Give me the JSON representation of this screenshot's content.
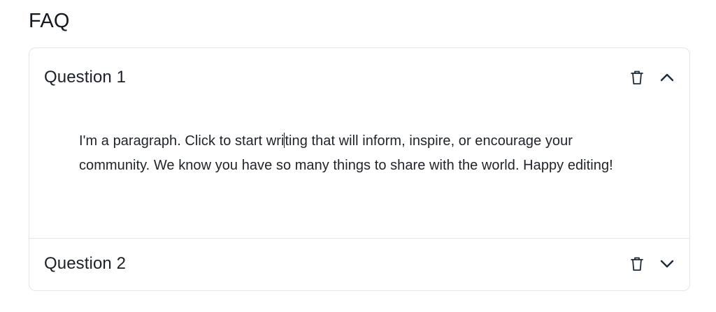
{
  "section": {
    "title": "FAQ"
  },
  "faq": {
    "items": [
      {
        "question": "Question 1",
        "answer_before_caret": "I'm a paragraph. Click to start wri",
        "answer_after_caret": "ting that will inform, inspire, or encourage your community. We know you have so many things to share with the world. Happy editing!",
        "expanded": true,
        "delete_icon": "trash-icon",
        "toggle_icon": "chevron-up-icon"
      },
      {
        "question": "Question 2",
        "expanded": false,
        "delete_icon": "trash-icon",
        "toggle_icon": "chevron-down-icon"
      }
    ]
  },
  "colors": {
    "text": "#1f2328",
    "border": "#e3e5e8",
    "icon": "#1c2b3a"
  }
}
